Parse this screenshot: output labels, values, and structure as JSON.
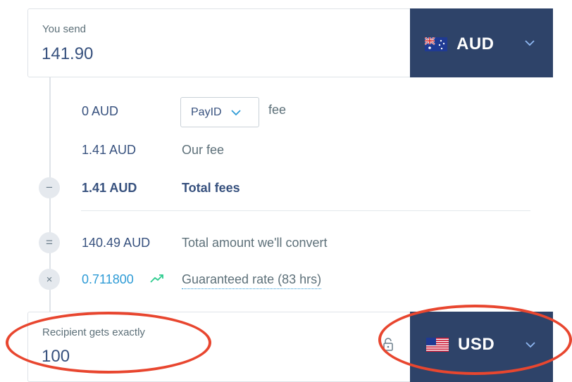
{
  "send": {
    "label": "You send",
    "value": "141.90",
    "currency": "AUD",
    "flag_icon": "australia-flag-icon"
  },
  "fees": {
    "payment_fee_amount": "0 AUD",
    "payment_method": "PayID",
    "payment_fee_label": "fee",
    "our_fee_amount": "1.41 AUD",
    "our_fee_label": "Our fee",
    "total_fees_amount": "1.41 AUD",
    "total_fees_label": "Total fees",
    "convert_amount": "140.49 AUD",
    "convert_label": "Total amount we'll convert",
    "rate": "0.711800",
    "rate_label": "Guaranteed rate (83 hrs)"
  },
  "receive": {
    "label": "Recipient gets exactly",
    "value": "100",
    "currency": "USD",
    "flag_icon": "usa-flag-icon"
  },
  "colors": {
    "accent": "#2e4369",
    "link": "#2e9bd6",
    "rate_up": "#2ecc8f",
    "annotation": "#e8462f"
  }
}
